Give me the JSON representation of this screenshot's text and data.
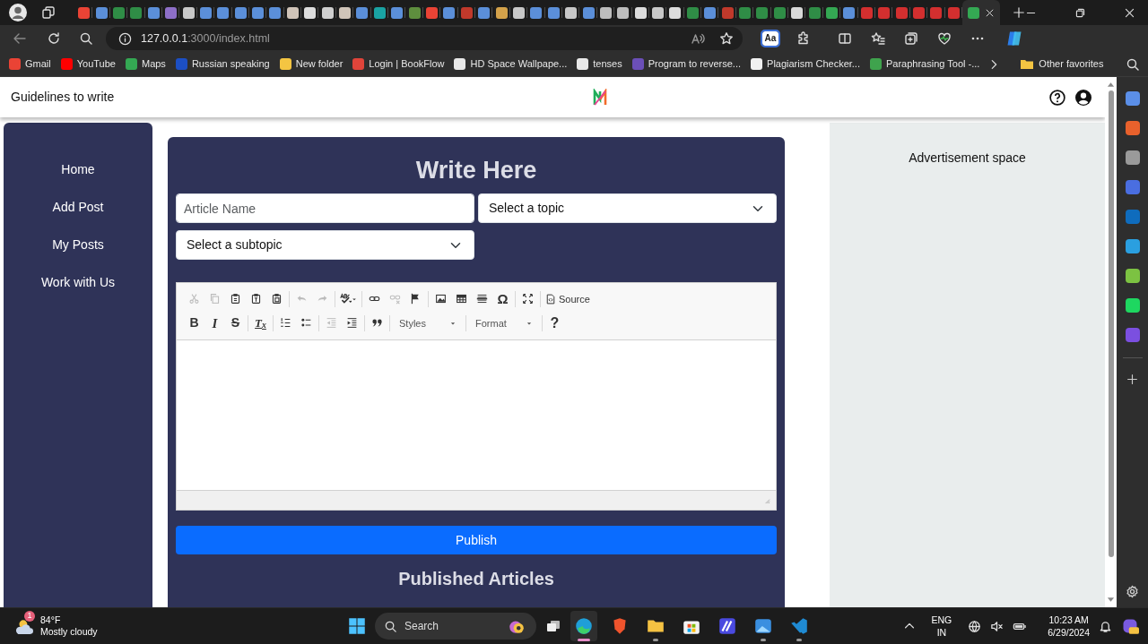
{
  "browser": {
    "tabs": [
      {
        "color": "#ea4335",
        "selected": false
      },
      {
        "color": "#5b8fd9",
        "selected": false
      },
      {
        "color": "#2f8d46",
        "selected": false
      },
      {
        "color": "#2f8d46",
        "selected": false
      },
      {
        "color": "#5b8fd9",
        "selected": false
      },
      {
        "color": "#8e6fc8",
        "selected": false
      },
      {
        "color": "#c8c8c8",
        "selected": false
      },
      {
        "color": "#5b8fd9",
        "selected": false
      },
      {
        "color": "#5b8fd9",
        "selected": false
      },
      {
        "color": "#5b8fd9",
        "selected": false
      },
      {
        "color": "#5b8fd9",
        "selected": false
      },
      {
        "color": "#5b8fd9",
        "selected": false
      },
      {
        "color": "#d0c4b8",
        "selected": false
      },
      {
        "color": "#dddddd",
        "selected": false
      },
      {
        "color": "#cfcfcf",
        "selected": false
      },
      {
        "color": "#d0c4b8",
        "selected": false
      },
      {
        "color": "#5b8fd9",
        "selected": false
      },
      {
        "color": "#1aa3a3",
        "selected": false
      },
      {
        "color": "#5b8fd9",
        "selected": false
      },
      {
        "color": "#5e8e3e",
        "selected": false
      },
      {
        "color": "#ea4335",
        "selected": false
      },
      {
        "color": "#5b8fd9",
        "selected": false
      },
      {
        "color": "#c0392b",
        "selected": false
      },
      {
        "color": "#5b8fd9",
        "selected": false
      },
      {
        "color": "#d4a24a",
        "selected": false
      },
      {
        "color": "#c8c8c8",
        "selected": false
      },
      {
        "color": "#5b8fd9",
        "selected": false
      },
      {
        "color": "#5b8fd9",
        "selected": false
      },
      {
        "color": "#c8c8c8",
        "selected": false
      },
      {
        "color": "#5b8fd9",
        "selected": false
      },
      {
        "color": "#bdbdbd",
        "selected": false
      },
      {
        "color": "#bdbdbd",
        "selected": false
      },
      {
        "color": "#dddddd",
        "selected": false
      },
      {
        "color": "#c8c8c8",
        "selected": false
      },
      {
        "color": "#dddddd",
        "selected": false
      },
      {
        "color": "#2f8d46",
        "selected": false
      },
      {
        "color": "#5b8fd9",
        "selected": false
      },
      {
        "color": "#c0392b",
        "selected": false
      },
      {
        "color": "#2f8d46",
        "selected": false
      },
      {
        "color": "#2f8d46",
        "selected": false
      },
      {
        "color": "#2f8d46",
        "selected": false
      },
      {
        "color": "#d8d8d8",
        "selected": false
      },
      {
        "color": "#2f8d46",
        "selected": false
      },
      {
        "color": "#34a853",
        "selected": false
      },
      {
        "color": "#5b8fd9",
        "selected": false
      },
      {
        "color": "#d32f2f",
        "selected": false
      },
      {
        "color": "#d32f2f",
        "selected": false
      },
      {
        "color": "#d32f2f",
        "selected": false
      },
      {
        "color": "#d32f2f",
        "selected": false
      },
      {
        "color": "#d32f2f",
        "selected": false
      },
      {
        "color": "#d32f2f",
        "selected": false
      },
      {
        "color": "#34a853",
        "selected": true
      }
    ],
    "address": {
      "host": "127.0.0.1",
      "path": ":3000/index.html"
    },
    "reader_button": "Aa",
    "bookmarks": [
      {
        "label": "Gmail",
        "color": "#ea4335"
      },
      {
        "label": "YouTube",
        "color": "#ff0000"
      },
      {
        "label": "Maps",
        "color": "#34a853"
      },
      {
        "label": "Russian speaking",
        "color": "#1c4fc4"
      },
      {
        "label": "New folder",
        "color": "#f4c542"
      },
      {
        "label": "Login | BookFlow",
        "color": "#e0443a"
      },
      {
        "label": "HD Space Wallpape...",
        "color": "#e8e8e8"
      },
      {
        "label": "tenses",
        "color": "#e8e8e8"
      },
      {
        "label": "Program to reverse...",
        "color": "#6b4fb8"
      },
      {
        "label": "Plagiarism Checker...",
        "color": "#f0f0f0"
      },
      {
        "label": "Paraphrasing Tool -...",
        "color": "#3fa34d"
      }
    ],
    "other_favorites": "Other favorites",
    "side_apps": [
      {
        "color": "#5b8fe8"
      },
      {
        "color": "#e8612c"
      },
      {
        "color": "#9a9a9a"
      },
      {
        "color": "#4a6ee0"
      },
      {
        "color": "#0f6cbd"
      },
      {
        "color": "#2a9fe0"
      },
      {
        "color": "#7cc242"
      },
      {
        "color": "#1ed760"
      },
      {
        "color": "#7b4fe0"
      }
    ]
  },
  "page": {
    "header": {
      "title": "Guidelines to write"
    },
    "nav": [
      {
        "label": "Home"
      },
      {
        "label": "Add Post"
      },
      {
        "label": "My Posts"
      },
      {
        "label": "Work with Us"
      }
    ],
    "form": {
      "heading": "Write Here",
      "article_placeholder": "Article Name",
      "topic": "Select a topic",
      "subtopic": "Select a subtopic",
      "toolbar": [
        [
          [
            {
              "kind": "cut",
              "disabled": true
            },
            {
              "kind": "copy",
              "disabled": true
            },
            {
              "kind": "paste",
              "disabled": false
            },
            {
              "kind": "paste-text",
              "disabled": false
            },
            {
              "kind": "paste-word",
              "disabled": false
            }
          ],
          [
            {
              "kind": "undo",
              "disabled": true
            },
            {
              "kind": "redo",
              "disabled": true
            }
          ],
          [
            {
              "kind": "spellcheck",
              "disabled": false
            }
          ],
          [
            {
              "kind": "link",
              "disabled": false
            },
            {
              "kind": "unlink",
              "disabled": true
            },
            {
              "kind": "anchor",
              "disabled": false
            }
          ],
          [
            {
              "kind": "image",
              "disabled": false
            },
            {
              "kind": "table",
              "disabled": false
            },
            {
              "kind": "hr",
              "disabled": false
            },
            {
              "kind": "char",
              "label": "Ω",
              "disabled": false
            }
          ],
          [
            {
              "kind": "maximize",
              "disabled": false
            }
          ],
          [
            {
              "kind": "source",
              "label": "Source",
              "disabled": false
            }
          ]
        ],
        [
          [
            {
              "kind": "bold",
              "label": "B",
              "disabled": false
            },
            {
              "kind": "italic",
              "label": "I",
              "disabled": false
            },
            {
              "kind": "strike",
              "label": "S",
              "disabled": false
            }
          ],
          [
            {
              "kind": "removeformat",
              "label": "T$_{x}$",
              "disabled": false
            }
          ],
          [
            {
              "kind": "numbered-list",
              "disabled": false
            },
            {
              "kind": "bulleted-list",
              "disabled": false
            }
          ],
          [
            {
              "kind": "outdent",
              "disabled": true
            },
            {
              "kind": "indent",
              "disabled": false
            }
          ],
          [
            {
              "kind": "blockquote",
              "disabled": false
            }
          ],
          [
            {
              "kind": "combo",
              "label": "Styles",
              "disabled": false
            }
          ],
          [
            {
              "kind": "combo",
              "label": "Format",
              "disabled": false
            }
          ],
          [
            {
              "kind": "help",
              "label": "?",
              "disabled": false
            }
          ]
        ]
      ],
      "publish": "Publish",
      "published_heading": "Published Articles"
    },
    "ad": "Advertisement space"
  },
  "taskbar": {
    "weather": {
      "badge": "1",
      "temp": "84°F",
      "desc": "Mostly cloudy"
    },
    "search": "Search",
    "apps": [
      {
        "kind": "edge",
        "color": "#1f9fd8",
        "running": true,
        "selected": true
      },
      {
        "kind": "brave",
        "color": "#f0542d",
        "running": false,
        "selected": false
      },
      {
        "kind": "folder",
        "color": "#f5c242",
        "running": true,
        "selected": false
      },
      {
        "kind": "store",
        "color": "#f3f3f3",
        "running": false,
        "selected": false
      },
      {
        "kind": "square",
        "color": "#4a4ae0",
        "running": false,
        "selected": false
      },
      {
        "kind": "photos",
        "color": "#3a8fe0",
        "running": true,
        "selected": false
      },
      {
        "kind": "code",
        "color": "#1f8ad2",
        "running": true,
        "selected": false
      }
    ],
    "lang": "ENG",
    "region": "IN",
    "time": "10:23 AM",
    "date": "6/29/2024"
  }
}
